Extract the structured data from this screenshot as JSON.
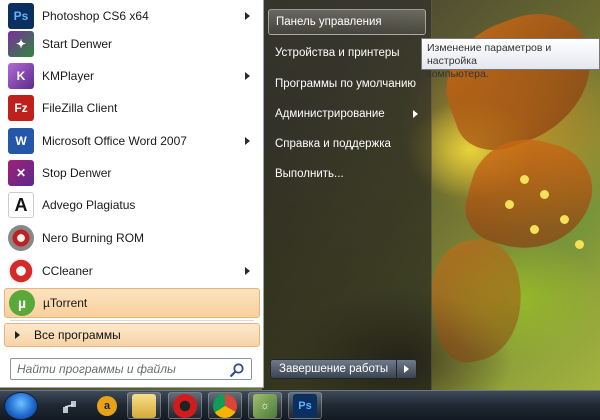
{
  "programs": [
    {
      "label": "Photoshop CS6 x64",
      "icon": "photoshop-icon",
      "has_submenu": true
    },
    {
      "label": "Start Denwer",
      "icon": "denwer-start-icon",
      "has_submenu": false
    },
    {
      "label": "KMPlayer",
      "icon": "kmplayer-icon",
      "has_submenu": true
    },
    {
      "label": "FileZilla Client",
      "icon": "filezilla-icon",
      "has_submenu": false
    },
    {
      "label": "Microsoft Office Word 2007",
      "icon": "word-icon",
      "has_submenu": true
    },
    {
      "label": "Stop Denwer",
      "icon": "denwer-stop-icon",
      "has_submenu": false
    },
    {
      "label": "Advego Plagiatus",
      "icon": "advego-icon",
      "has_submenu": false
    },
    {
      "label": "Nero Burning ROM",
      "icon": "nero-icon",
      "has_submenu": false
    },
    {
      "label": "CCleaner",
      "icon": "ccleaner-icon",
      "has_submenu": true
    },
    {
      "label": "µTorrent",
      "icon": "utorrent-icon",
      "has_submenu": false
    }
  ],
  "all_programs_label": "Все программы",
  "search": {
    "placeholder": "Найти программы и файлы"
  },
  "right_pane": [
    {
      "label": "Панель управления",
      "has_submenu": false,
      "active": true
    },
    {
      "label": "Устройства и принтеры",
      "has_submenu": false,
      "active": false
    },
    {
      "label": "Программы по умолчанию",
      "has_submenu": false,
      "active": false
    },
    {
      "label": "Администрирование",
      "has_submenu": true,
      "active": false
    },
    {
      "label": "Справка и поддержка",
      "has_submenu": false,
      "active": false
    },
    {
      "label": "Выполнить...",
      "has_submenu": false,
      "active": false
    }
  ],
  "tooltip": {
    "line1": "Изменение параметров и настройка",
    "line2": "компьютера."
  },
  "shutdown_label": "Завершение работы",
  "taskbar": {
    "icons": [
      "start-orb-icon",
      "network-icon",
      "avast-icon",
      "explorer-folder-icon",
      "opera-icon",
      "chrome-icon",
      "denwer-taskbar-icon",
      "photoshop-taskbar-icon"
    ]
  },
  "colors": {
    "highlight": "#f9cf9c",
    "menu_bg": "#ffffff",
    "taskbar": "#1f2833"
  }
}
